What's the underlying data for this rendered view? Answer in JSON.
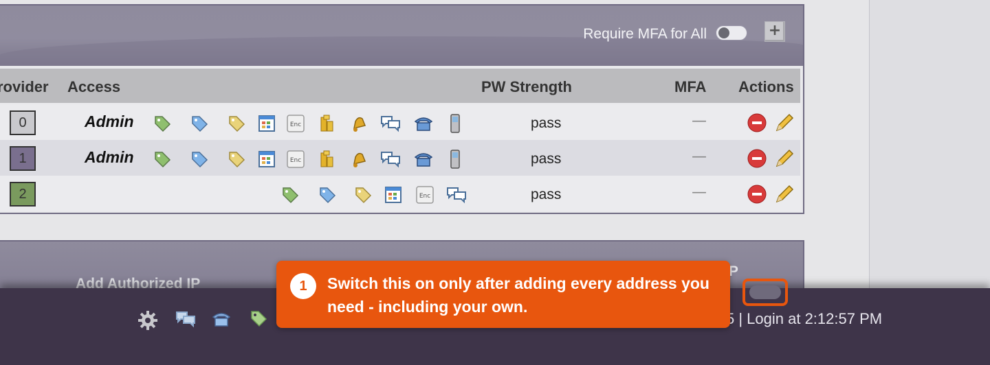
{
  "panel": {
    "mfa_toggle_label": "Require MFA for All",
    "mfa_toggle_state": "off",
    "add_label": "+"
  },
  "table": {
    "headers": {
      "provider": "rovider",
      "access": "Access",
      "pw_strength": "PW Strength",
      "mfa": "MFA",
      "actions": "Actions"
    },
    "rows": [
      {
        "id": "0",
        "id_color": "#c9c9cd",
        "access": "Admin",
        "pw": "pass",
        "mfa": "—"
      },
      {
        "id": "1",
        "id_color": "#7a6f8e",
        "access": "Admin",
        "pw": "pass",
        "mfa": "—"
      },
      {
        "id": "2",
        "id_color": "#7a9a5e",
        "access": "",
        "pw": "pass",
        "mfa": "—"
      }
    ]
  },
  "panel2": {
    "label": "Add Authorized IP",
    "ip_label": "IP"
  },
  "footer": {
    "login_text": "5 | Login at 2:12:57 PM"
  },
  "callout": {
    "number": "1",
    "text": "Switch this on only after adding every address you need - including your own."
  },
  "colors": {
    "accent": "#e8560e",
    "footer_bg": "#3e3449",
    "header_bg": "#8f8b9d"
  }
}
